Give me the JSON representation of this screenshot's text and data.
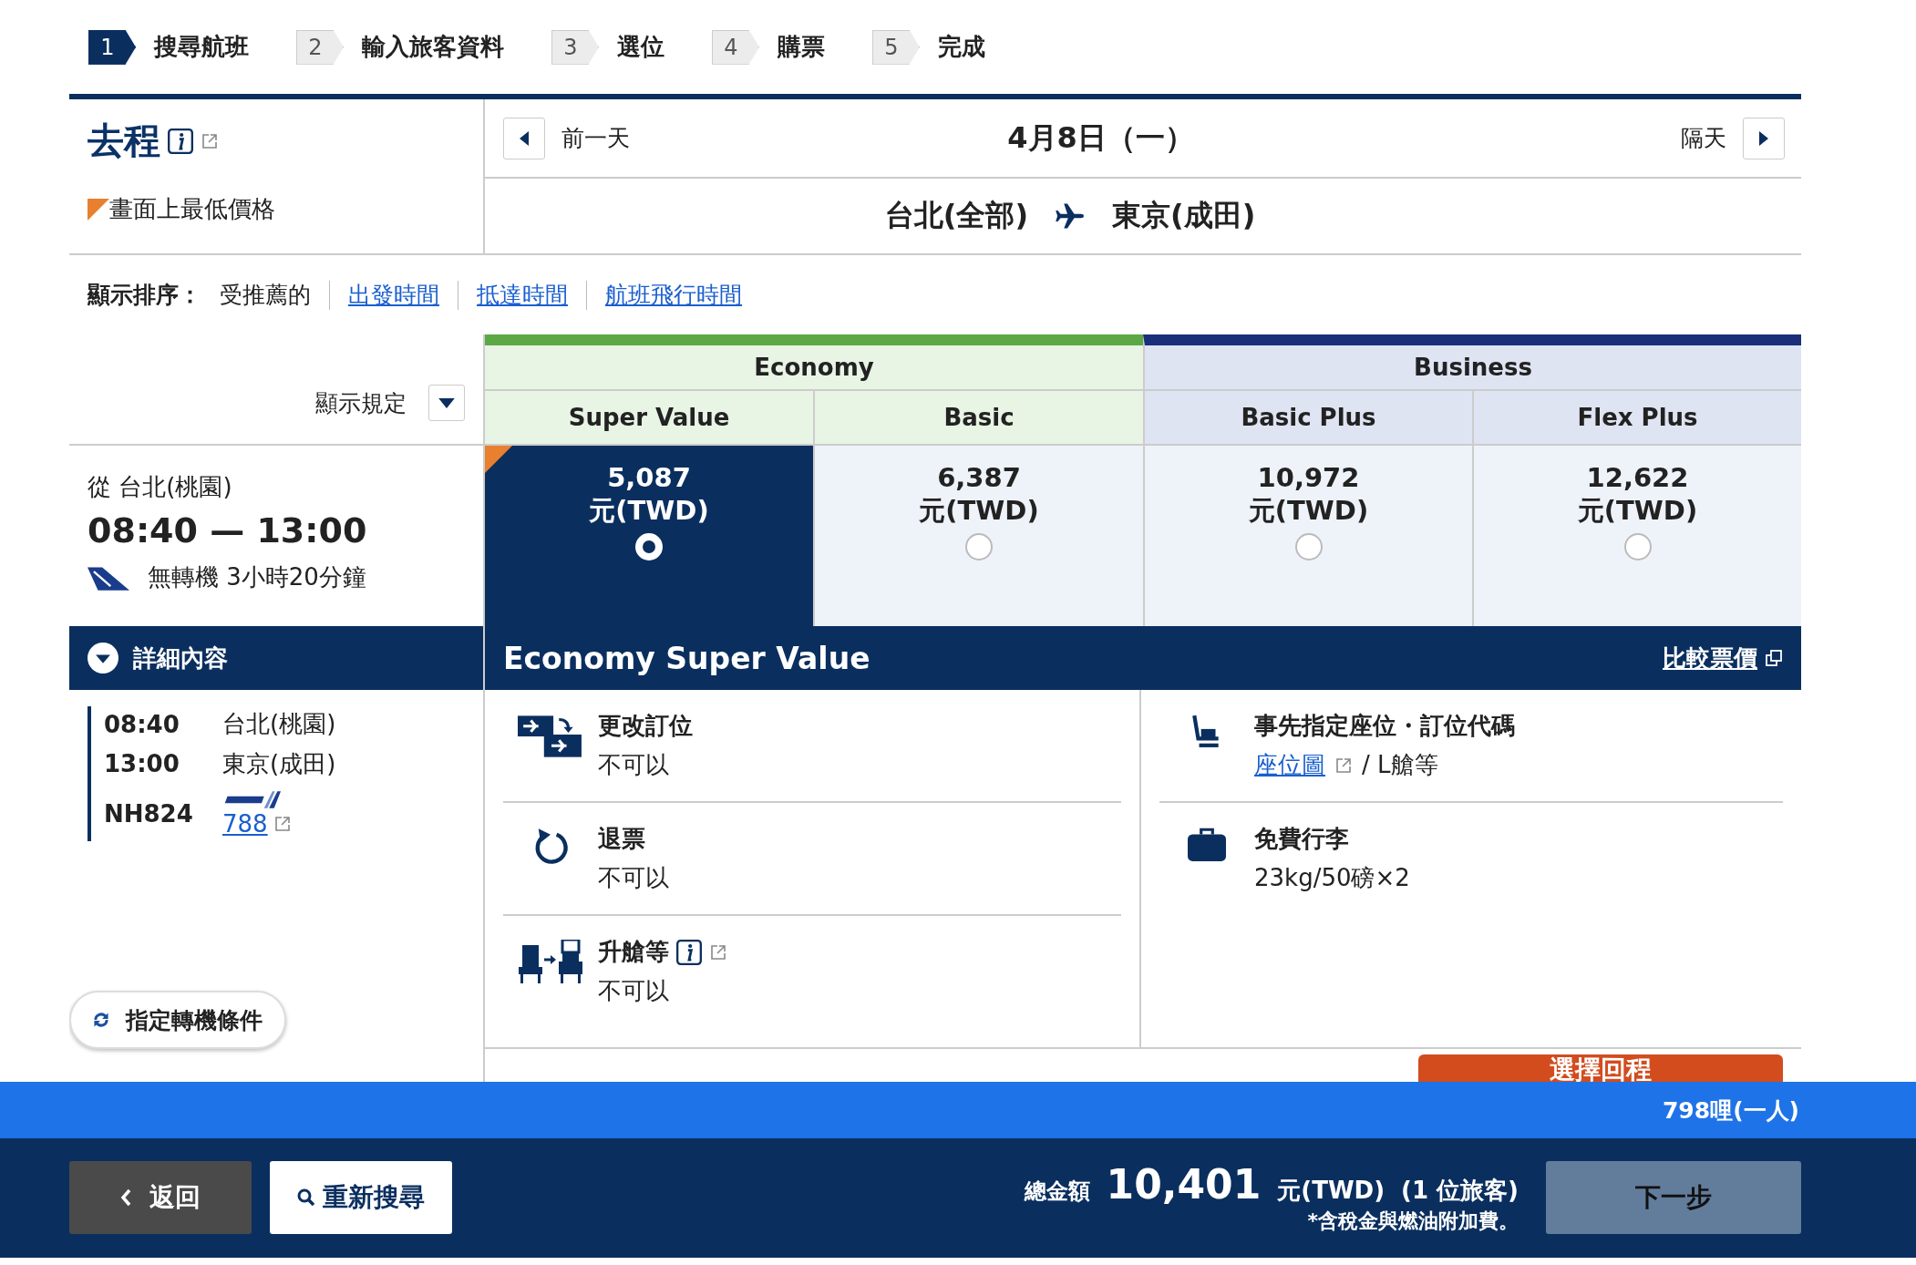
{
  "steps": [
    {
      "number": "1",
      "label": "搜尋航班",
      "selected": true
    },
    {
      "number": "2",
      "label": "輸入旅客資料",
      "selected": false
    },
    {
      "number": "3",
      "label": "選位",
      "selected": false
    },
    {
      "number": "4",
      "label": "購票",
      "selected": false
    },
    {
      "number": "5",
      "label": "完成",
      "selected": false
    }
  ],
  "outbound": {
    "title": "去程",
    "lowest_price_legend": "畫面上最低價格"
  },
  "date_nav": {
    "prev_label": "前一天",
    "date": "4月8日（一）",
    "next_label": "隔天"
  },
  "route": {
    "from": "台北(全部)",
    "to": "東京(成田)"
  },
  "sort": {
    "label": "顯示排序：",
    "options": [
      {
        "label": "受推薦的",
        "selected": true
      },
      {
        "label": "出發時間",
        "selected": false
      },
      {
        "label": "抵達時間",
        "selected": false
      },
      {
        "label": "航班飛行時間",
        "selected": false
      }
    ]
  },
  "display_rules": {
    "label": "顯示規定"
  },
  "flight": {
    "from": "從 台北(桃園)",
    "times": "08:40 — 13:00",
    "info": "無轉機 3小時20分鐘"
  },
  "cabins": [
    {
      "name": "Economy",
      "kind": "economy",
      "fares": [
        {
          "name": "Super Value",
          "price": "5,087",
          "currency": "元(TWD)",
          "selected": true,
          "lowest": true
        },
        {
          "name": "Basic",
          "price": "6,387",
          "currency": "元(TWD)",
          "selected": false,
          "lowest": false
        }
      ]
    },
    {
      "name": "Business",
      "kind": "business",
      "fares": [
        {
          "name": "Basic Plus",
          "price": "10,972",
          "currency": "元(TWD)",
          "selected": false,
          "lowest": false
        },
        {
          "name": "Flex Plus",
          "price": "12,622",
          "currency": "元(TWD)",
          "selected": false,
          "lowest": false
        }
      ]
    }
  ],
  "details": {
    "label": "詳細內容",
    "expanded": true
  },
  "segment": {
    "dep_time": "08:40",
    "dep_airport": "台北(桃園)",
    "arr_time": "13:00",
    "arr_airport": "東京(成田)",
    "flight_no": "NH824",
    "aircraft": "788"
  },
  "fare_detail": {
    "title": "Economy Super Value",
    "compare_link": "比較票價",
    "columns": [
      [
        {
          "kind": "change",
          "title": "更改訂位",
          "value": "不可以",
          "info": false
        },
        {
          "kind": "refund",
          "title": "退票",
          "value": "不可以",
          "info": false
        },
        {
          "kind": "upgrade",
          "title": "升艙等",
          "value": "不可以",
          "info": true
        }
      ],
      [
        {
          "kind": "seat",
          "title": "事先指定座位・訂位代碼",
          "link": "座位圖",
          "value": "/ L艙等",
          "info": false
        },
        {
          "kind": "baggage",
          "title": "免費行李",
          "value": "23kg/50磅×2",
          "info": false
        }
      ]
    ]
  },
  "transfer_button": "指定轉機條件",
  "return_button": "選擇回程",
  "mileage": "798哩(一人)",
  "footer": {
    "back": "返回",
    "research": "重新搜尋",
    "total_label": "總金額",
    "total": "10,401",
    "currency": "元(TWD)",
    "passengers": "(1 位旅客)",
    "note": "*含稅金與燃油附加費。",
    "next": "下一步"
  }
}
